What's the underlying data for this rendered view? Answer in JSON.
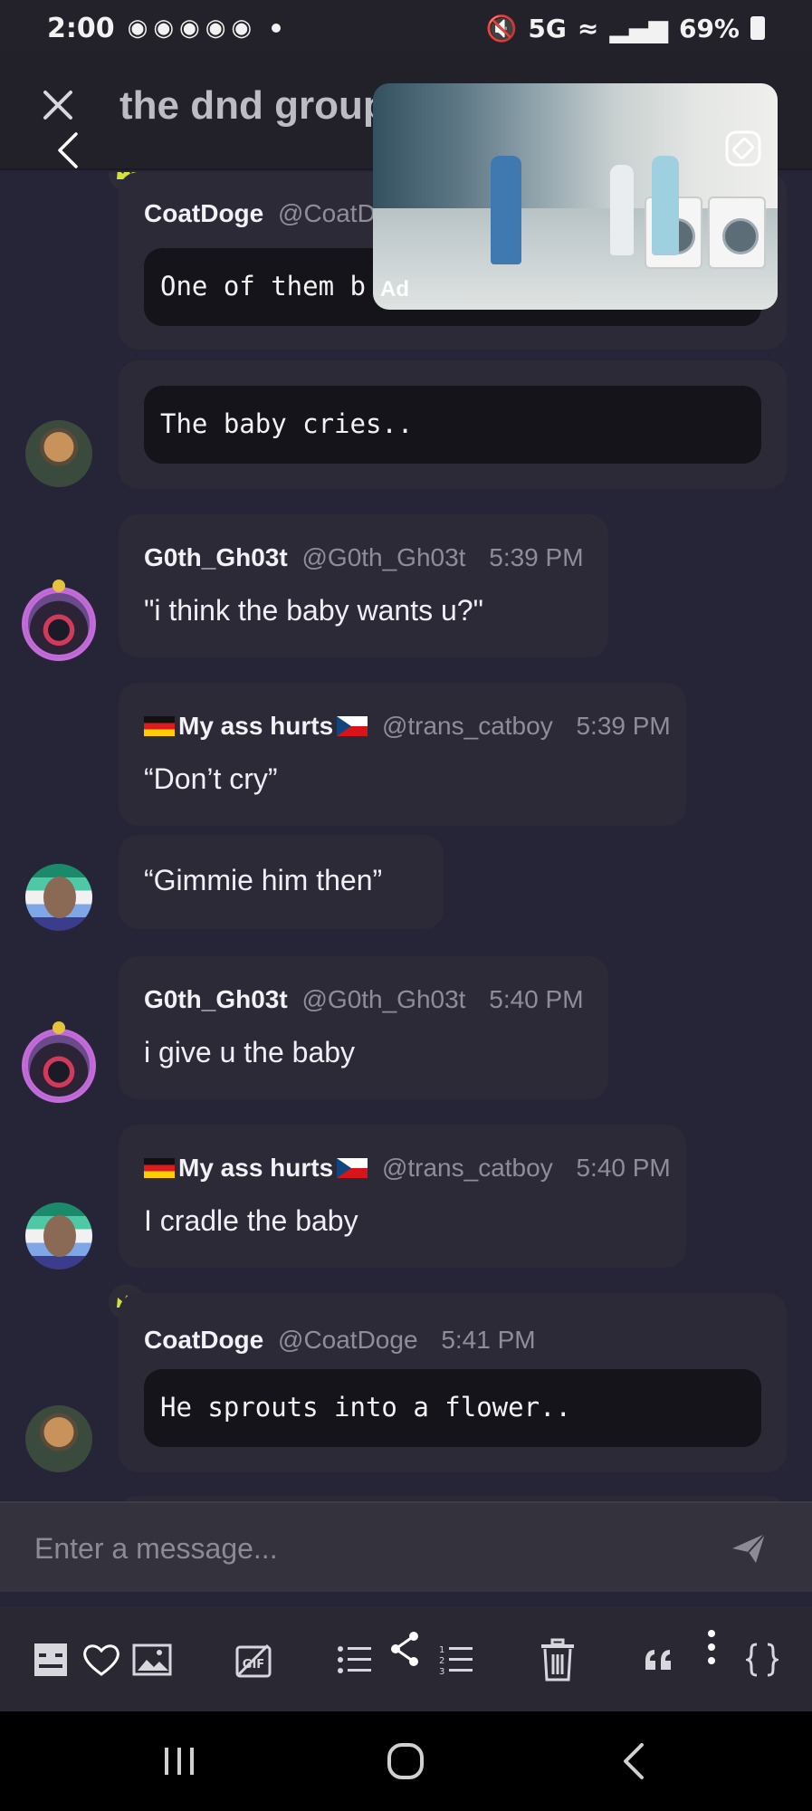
{
  "status_bar": {
    "time": "2:00",
    "notification_icons": [
      "discord-icon",
      "discord-icon",
      "discord-icon",
      "discord-icon",
      "discord-icon"
    ],
    "network": "5G",
    "battery": "69%"
  },
  "header": {
    "title": "the dnd group"
  },
  "ad": {
    "label": "Ad"
  },
  "messages": [
    {
      "user": "CoatDoge",
      "handle": "@CoatD",
      "code": "One of them b"
    },
    {
      "code": "The baby cries.."
    },
    {
      "user": "G0th_Gh03t",
      "handle": "@G0th_Gh03t",
      "time": "5:39 PM",
      "text": "\"i think the baby wants u?\""
    },
    {
      "user": "My ass hurts",
      "handle": "@trans_catboy",
      "time": "5:39 PM",
      "text": "“Don’t cry”"
    },
    {
      "text": "“Gimmie him then”"
    },
    {
      "user": "G0th_Gh03t",
      "handle": "@G0th_Gh03t",
      "time": "5:40 PM",
      "text": "i give u the baby"
    },
    {
      "user": "My ass hurts",
      "handle": "@trans_catboy",
      "time": "5:40 PM",
      "text": "I cradle the baby"
    },
    {
      "user": "CoatDoge",
      "handle": "@CoatDoge",
      "time": "5:41 PM",
      "code": "He sprouts into a flower.."
    }
  ],
  "composer": {
    "placeholder": "Enter a message..."
  },
  "toolbar": {
    "items": [
      "spoiler-icon",
      "heart-icon",
      "image-icon",
      "gif-icon",
      "bullet-list-icon",
      "share-icon",
      "numbered-list-icon",
      "delete-icon",
      "quote-icon",
      "more-icon",
      "code-block-icon"
    ]
  },
  "colors": {
    "background": "#262437",
    "bubble": "#2c2a36",
    "code_block": "#15141b",
    "crown": "#d4e33c",
    "ring": "#c26bd9"
  }
}
